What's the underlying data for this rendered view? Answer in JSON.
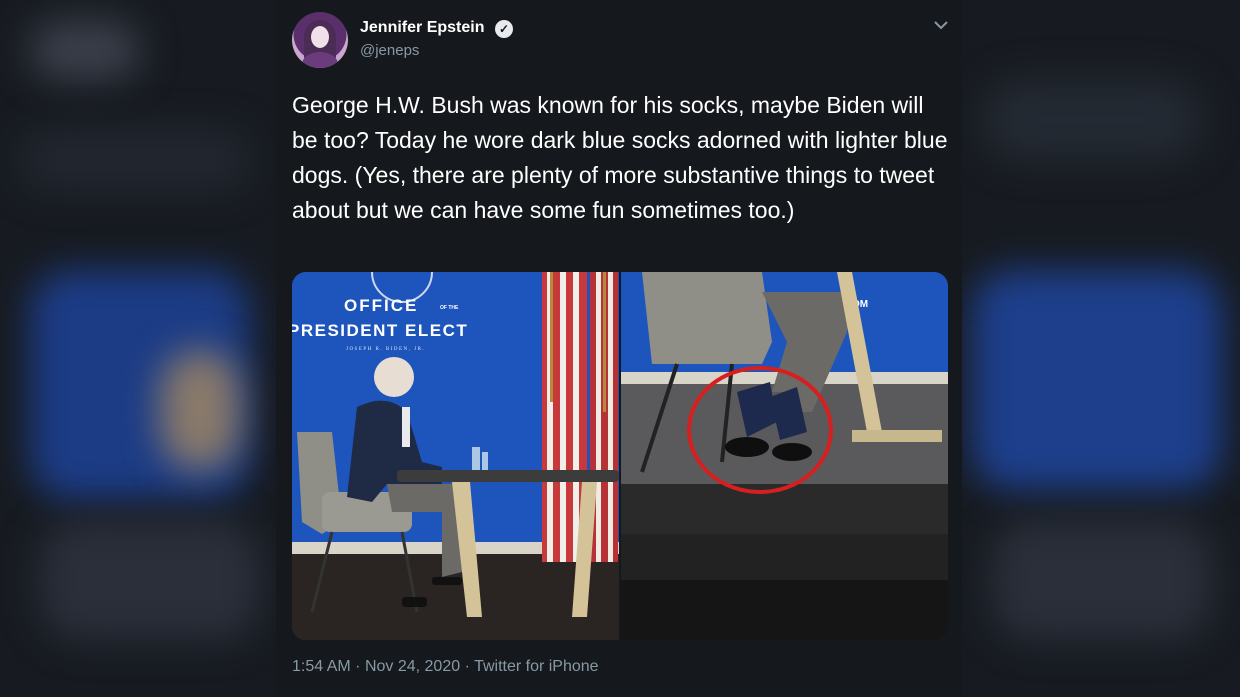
{
  "author": {
    "name": "Jennifer Epstein",
    "handle": "@jeneps"
  },
  "tweet": {
    "text": "George H.W. Bush was known for his socks, maybe Biden will be too? Today he wore dark blue socks adorned with lighter blue dogs. (Yes, there are plenty of more substantive things to tweet about but we can have some fun sometimes too.)",
    "time": "1:54 AM",
    "date": "Nov 24, 2020",
    "source": "Twitter for iPhone"
  },
  "media": {
    "banner_line1": "OFFICE",
    "banner_of_the": "OF THE",
    "banner_line2": "PRESIDENT ELECT",
    "banner_line3": "JOSEPH R. BIDEN, JR.",
    "banner_right_fragment": "OM"
  },
  "colors": {
    "background": "#15181c",
    "text": "#ffffff",
    "muted": "#8899a6",
    "circle": "#d61f1f"
  },
  "icons": [
    "verified-badge-icon",
    "chevron-down-icon"
  ]
}
